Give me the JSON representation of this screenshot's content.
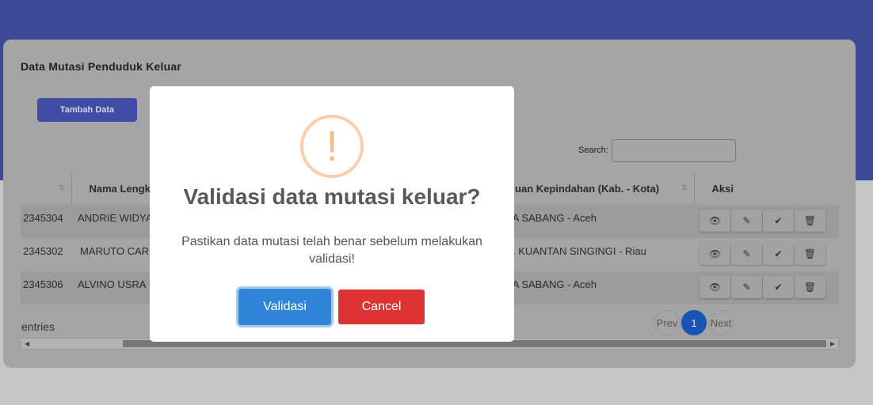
{
  "page": {
    "title": "Data Mutasi Penduduk Keluar",
    "add_button": "Tambah Data",
    "search_label": "Search:",
    "search_value": ""
  },
  "table": {
    "columns": [
      {
        "label": ""
      },
      {
        "label": "Nama Lengkap"
      },
      {
        "label": ""
      },
      {
        "label": "Tujuan Kepindahan (Kab. - Kota)"
      },
      {
        "label": "Aksi"
      }
    ],
    "rows": [
      {
        "id": "2345304",
        "nama": "ANDRIE WIDYA",
        "tujuan": "KOTA SABANG - Aceh"
      },
      {
        "id": "2345302",
        "nama": "MARUTO CAR",
        "tujuan": "KAB. KUANTAN SINGINGI - Riau"
      },
      {
        "id": "2345306",
        "nama": "ALVINO USRA",
        "tujuan": "KOTA SABANG - Aceh"
      }
    ],
    "action_icons": [
      "eye-icon",
      "edit-icon",
      "check-icon",
      "trash-icon"
    ]
  },
  "footer": {
    "entries_text": "entries",
    "pagination": {
      "prev": "Prev",
      "current": "1",
      "next": "Next"
    }
  },
  "modal": {
    "icon": "!",
    "title": "Validasi data mutasi keluar?",
    "text": "Pastikan data mutasi telah benar sebelum melakukan validasi!",
    "confirm_label": "Validasi",
    "cancel_label": "Cancel"
  },
  "colors": {
    "header_band": "#3d4896",
    "confirm": "#3085d6",
    "cancel": "#dd3333",
    "warning": "#f8bb86",
    "page_active": "#1a52b6"
  }
}
